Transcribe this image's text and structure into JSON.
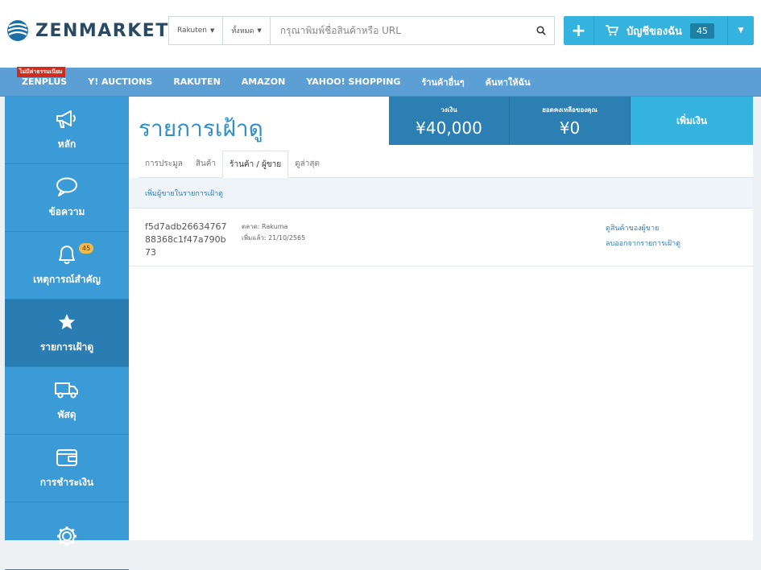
{
  "brand": {
    "name": "ZENMARKET"
  },
  "search": {
    "market_select": "Rakuten",
    "category_select": "ทั้งหมด",
    "placeholder": "กรุณาพิมพ์ชื่อสินค้าหรือ URL",
    "value": ""
  },
  "account": {
    "label": "บัญชีของฉัน",
    "count": "45"
  },
  "nav": {
    "badge": "ไม่มีค่าธรรมเนียม",
    "items": [
      "ZENPLUS",
      "Y! AUCTIONS",
      "RAKUTEN",
      "AMAZON",
      "YAHOO! SHOPPING",
      "ร้านค้าอื่นๆ",
      "ค้นหาให้ฉัน"
    ]
  },
  "sidebar": {
    "items": [
      {
        "label": "หลัก",
        "icon": "megaphone-icon"
      },
      {
        "label": "ข้อความ",
        "icon": "speech-bubble-icon"
      },
      {
        "label": "เหตุการณ์สำคัญ",
        "icon": "bell-icon",
        "badge": "45"
      },
      {
        "label": "รายการเฝ้าดู",
        "icon": "star-icon",
        "active": true
      },
      {
        "label": "พัสดุ",
        "icon": "truck-icon"
      },
      {
        "label": "การชำระเงิน",
        "icon": "wallet-icon"
      },
      {
        "label": "",
        "icon": "gear-icon"
      }
    ]
  },
  "page": {
    "title": "รายการเฝ้าดู",
    "stats": [
      {
        "label": "วงเงิน",
        "value": "¥40,000"
      },
      {
        "label": "ยอดคงเหลือของคุณ",
        "value": "¥0"
      }
    ],
    "topup_label": "เพิ่มเงิน",
    "tabs": [
      "การประมูล",
      "สินค้า",
      "ร้านค้า / ผู้ขาย",
      "ดูล่าสุด"
    ],
    "active_tab": 2,
    "add_seller_link": "เพิ่มผู้ขายในรายการเฝ้าดู",
    "sellers": [
      {
        "id": "f5d7adb2663476788368c1f47a790b73",
        "market": "ตลาด: Rakuma",
        "added": "เพิ่มแล้ว: 21/10/2565",
        "view_link": "ดูสินค้าของผู้ขาย",
        "remove_link": "ลบออกจากรายการเฝ้าดู"
      }
    ]
  },
  "colors": {
    "accent": "#35b3df",
    "nav": "#5b9fd4",
    "sidebar": "#3a9bd6",
    "sidebar_active": "#2a7db2",
    "stat_bg": "#2b7fb3",
    "title": "#2f8fc9",
    "nofee_badge": "#d42a1c",
    "alert_badge": "#f4b84a"
  }
}
